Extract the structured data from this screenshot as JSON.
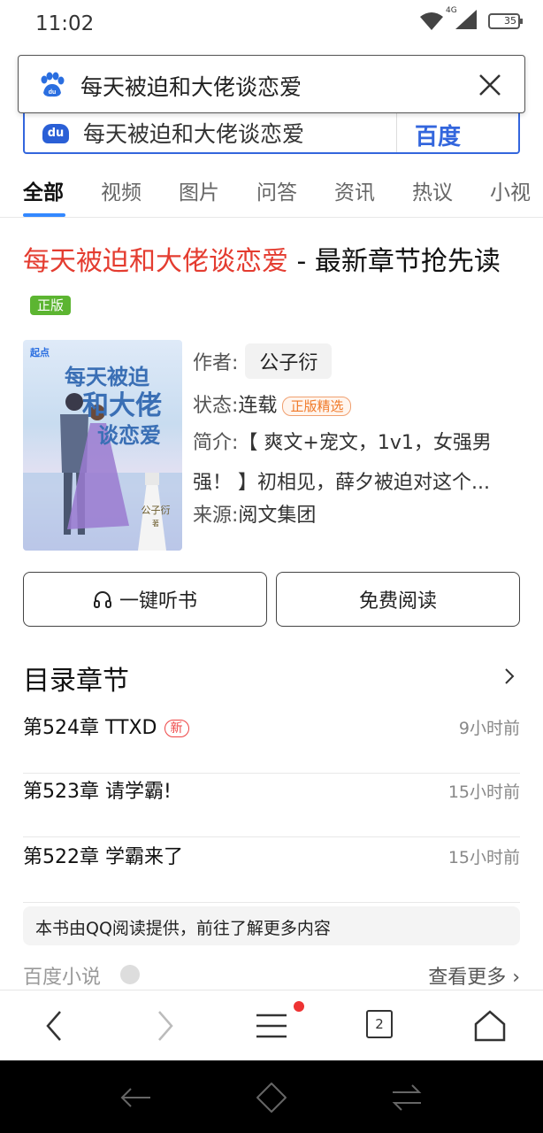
{
  "status_bar": {
    "time": "11:02",
    "network": "4G",
    "battery": "35"
  },
  "search_overlay": {
    "query": "每天被迫和大佬谈恋爱"
  },
  "under_search": {
    "query": "每天被迫和大佬谈恋爱",
    "logo": "du",
    "button": "百度"
  },
  "tabs": [
    {
      "label": "全部",
      "active": true
    },
    {
      "label": "视频"
    },
    {
      "label": "图片"
    },
    {
      "label": "问答"
    },
    {
      "label": "资讯"
    },
    {
      "label": "热议"
    },
    {
      "label": "小视"
    }
  ],
  "result": {
    "title_highlight": "每天被迫和大佬谈恋爱",
    "title_rest": " - 最新章节抢先读",
    "badge": "正版",
    "cover": {
      "publisher_logo": "起点",
      "title_lines": [
        "每天被迫",
        "和大佬",
        "谈恋爱"
      ],
      "author": "公子衍",
      "imprint": "著"
    },
    "author_label": "作者:",
    "author": "公子衍",
    "status_label": "状态:",
    "status": "连载",
    "status_tag": "正版精选",
    "desc_label": "简介:",
    "desc_line1": "【 爽文+宠文，1v1，女强男",
    "desc_line2": "强！ 】初相见，薛夕被迫对这个...",
    "source_label": "来源:",
    "source": "阅文集团",
    "listen_button": "一键听书",
    "read_button": "免费阅读"
  },
  "toc": {
    "heading": "目录章节",
    "chapters": [
      {
        "title": "第524章 TTXD",
        "tag": "新",
        "time": "9小时前"
      },
      {
        "title": "第523章 请学霸!",
        "time": "15小时前"
      },
      {
        "title": "第522章 学霸来了",
        "time": "15小时前"
      }
    ]
  },
  "provider_note": "本书由QQ阅读提供，前往了解更多内容",
  "footer": {
    "source": "百度小说",
    "more": "查看更多"
  },
  "toolbar": {
    "tab_count": "2"
  }
}
